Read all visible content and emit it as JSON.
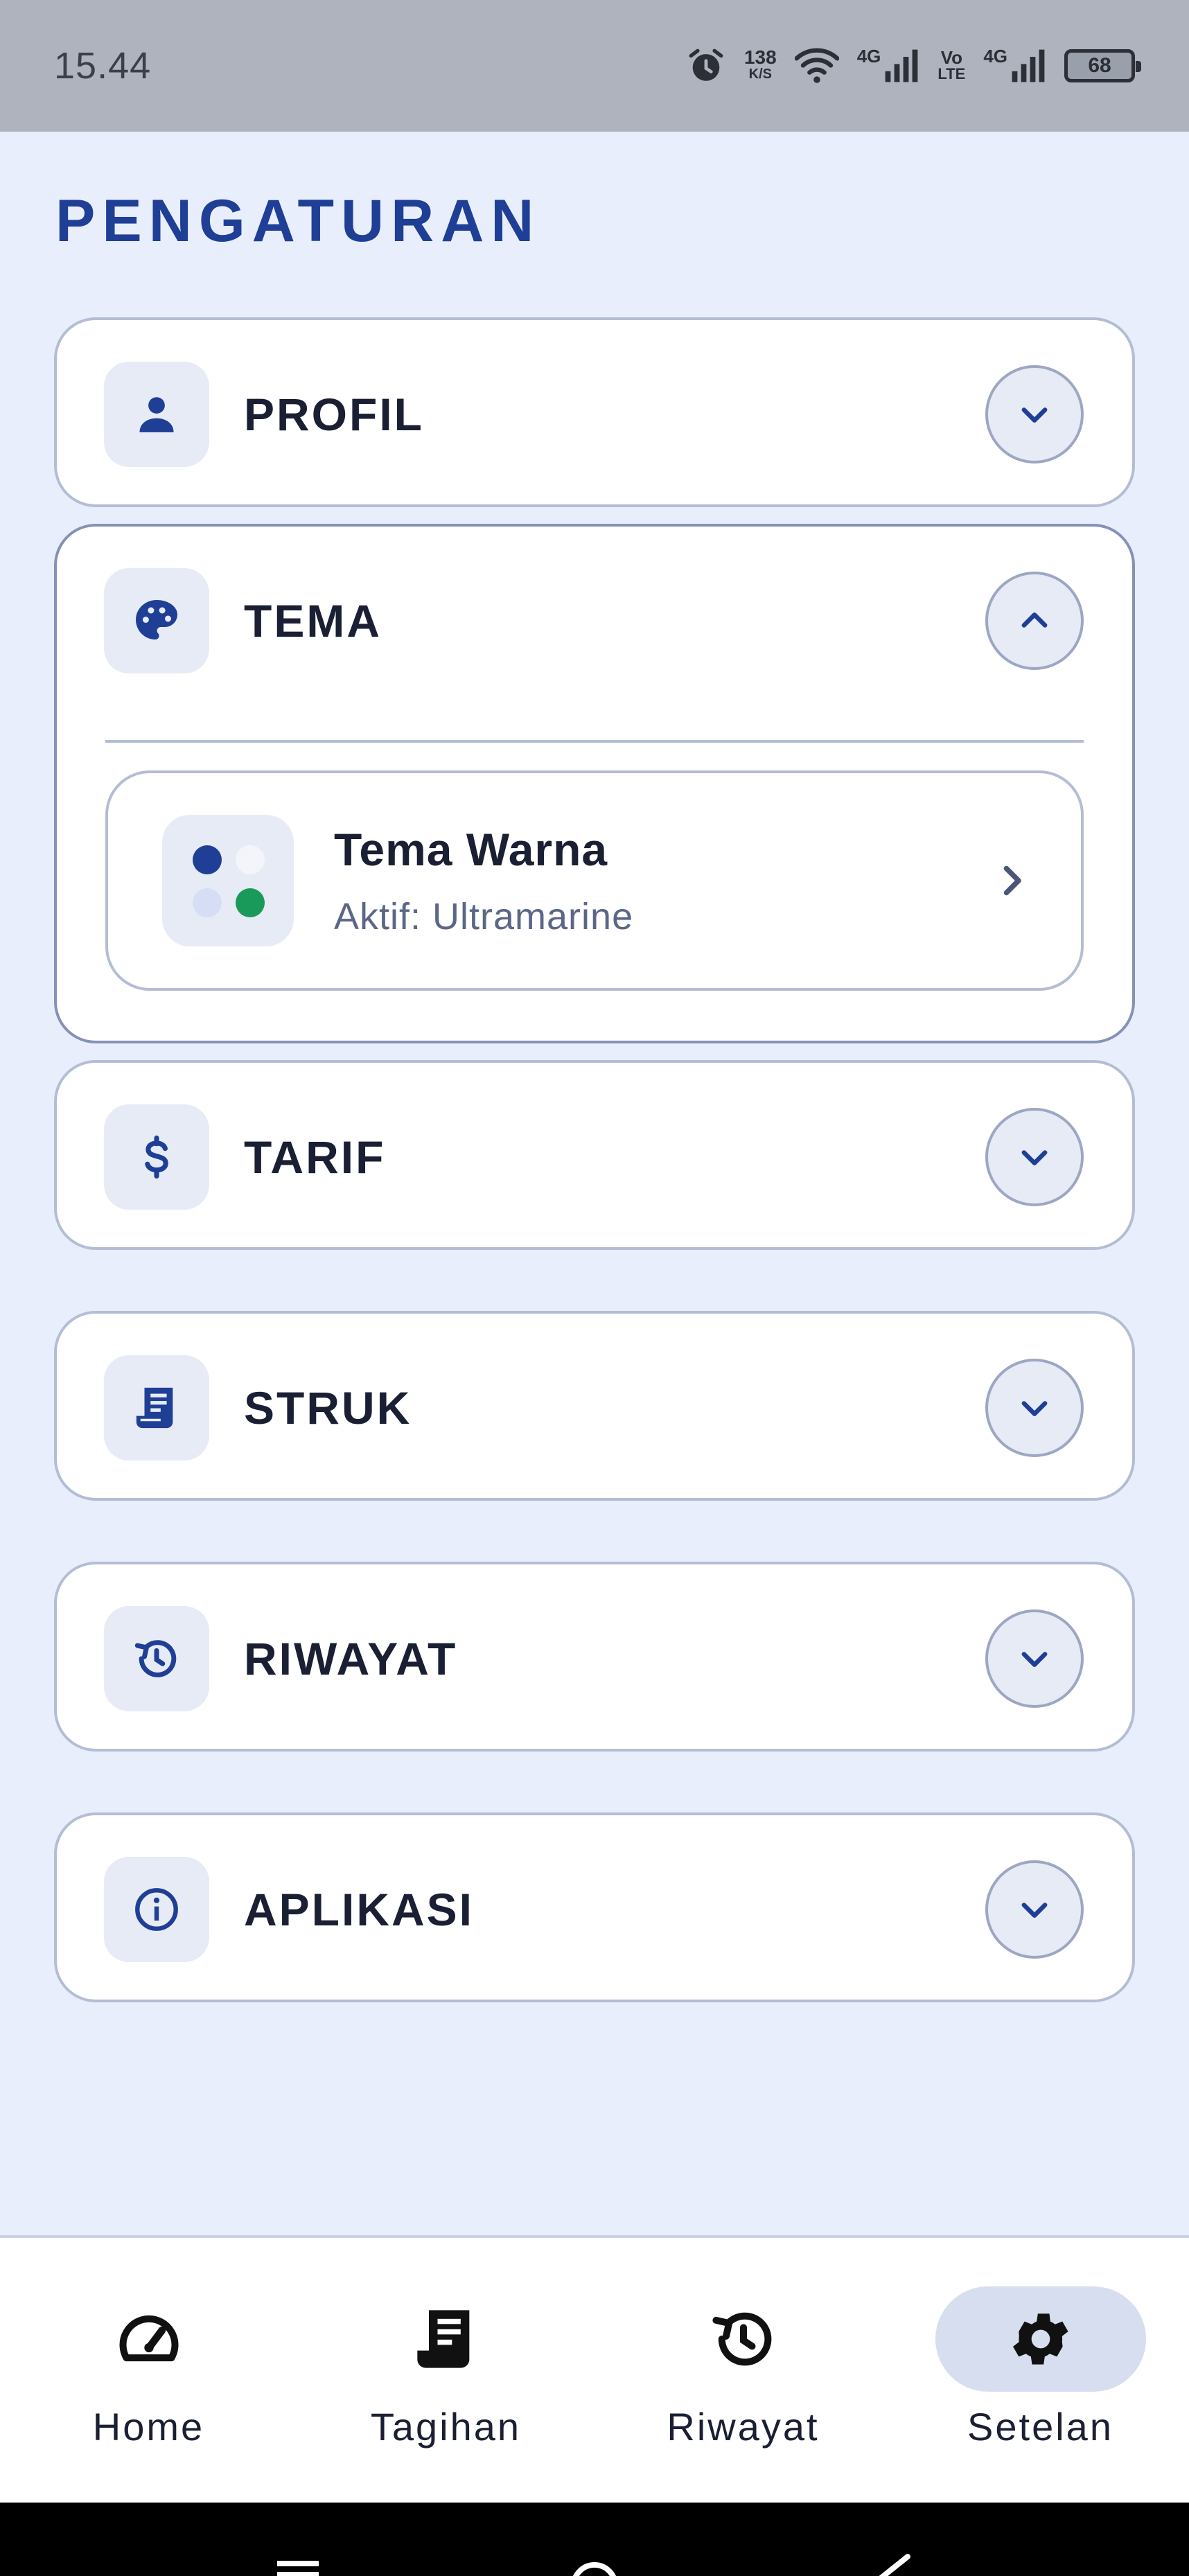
{
  "status_bar": {
    "time": "15.44",
    "net_speed_value": "138",
    "net_speed_unit": "K/S",
    "signal1_label": "4G",
    "volte_top": "Vo",
    "volte_bottom": "LTE",
    "signal2_label": "4G",
    "battery": "68"
  },
  "page": {
    "title": "PENGATURAN"
  },
  "sections": {
    "profil": {
      "title": "PROFIL",
      "icon": "person-icon"
    },
    "tema": {
      "title": "TEMA",
      "icon": "palette-icon",
      "expanded": true,
      "item": {
        "title": "Tema Warna",
        "subtitle": "Aktif: Ultramarine"
      }
    },
    "tarif": {
      "title": "TARIF",
      "icon": "dollar-icon"
    },
    "struk": {
      "title": "STRUK",
      "icon": "receipt-icon"
    },
    "riwayat": {
      "title": "RIWAYAT",
      "icon": "history-icon"
    },
    "aplikasi": {
      "title": "APLIKASI",
      "icon": "info-icon"
    }
  },
  "nav": {
    "home": "Home",
    "tagihan": "Tagihan",
    "riwayat": "Riwayat",
    "setelan": "Setelan",
    "active": "setelan"
  },
  "colors": {
    "accent": "#1f3f96",
    "background": "#e8eefc",
    "theme_dot_primary": "#1f3f96",
    "theme_dot_secondary": "#1a9a5a"
  }
}
